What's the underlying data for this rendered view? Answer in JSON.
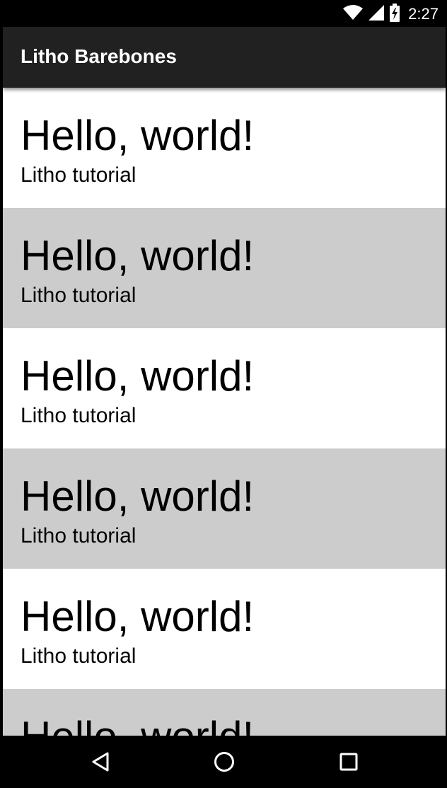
{
  "status_bar": {
    "time": "2:27",
    "icons": [
      "wifi-icon",
      "cell-signal-icon",
      "battery-charging-icon"
    ]
  },
  "app_bar": {
    "title": "Litho Barebones",
    "background": "#212121"
  },
  "list": {
    "colors": {
      "even": "#ffffff",
      "odd": "#cccccc"
    },
    "items": [
      {
        "title": "Hello, world!",
        "subtitle": "Litho tutorial"
      },
      {
        "title": "Hello, world!",
        "subtitle": "Litho tutorial"
      },
      {
        "title": "Hello, world!",
        "subtitle": "Litho tutorial"
      },
      {
        "title": "Hello, world!",
        "subtitle": "Litho tutorial"
      },
      {
        "title": "Hello, world!",
        "subtitle": "Litho tutorial"
      },
      {
        "title": "Hello, world!",
        "subtitle": ""
      }
    ]
  },
  "nav_bar": {
    "buttons": [
      "back-icon",
      "home-icon",
      "recents-icon"
    ]
  }
}
